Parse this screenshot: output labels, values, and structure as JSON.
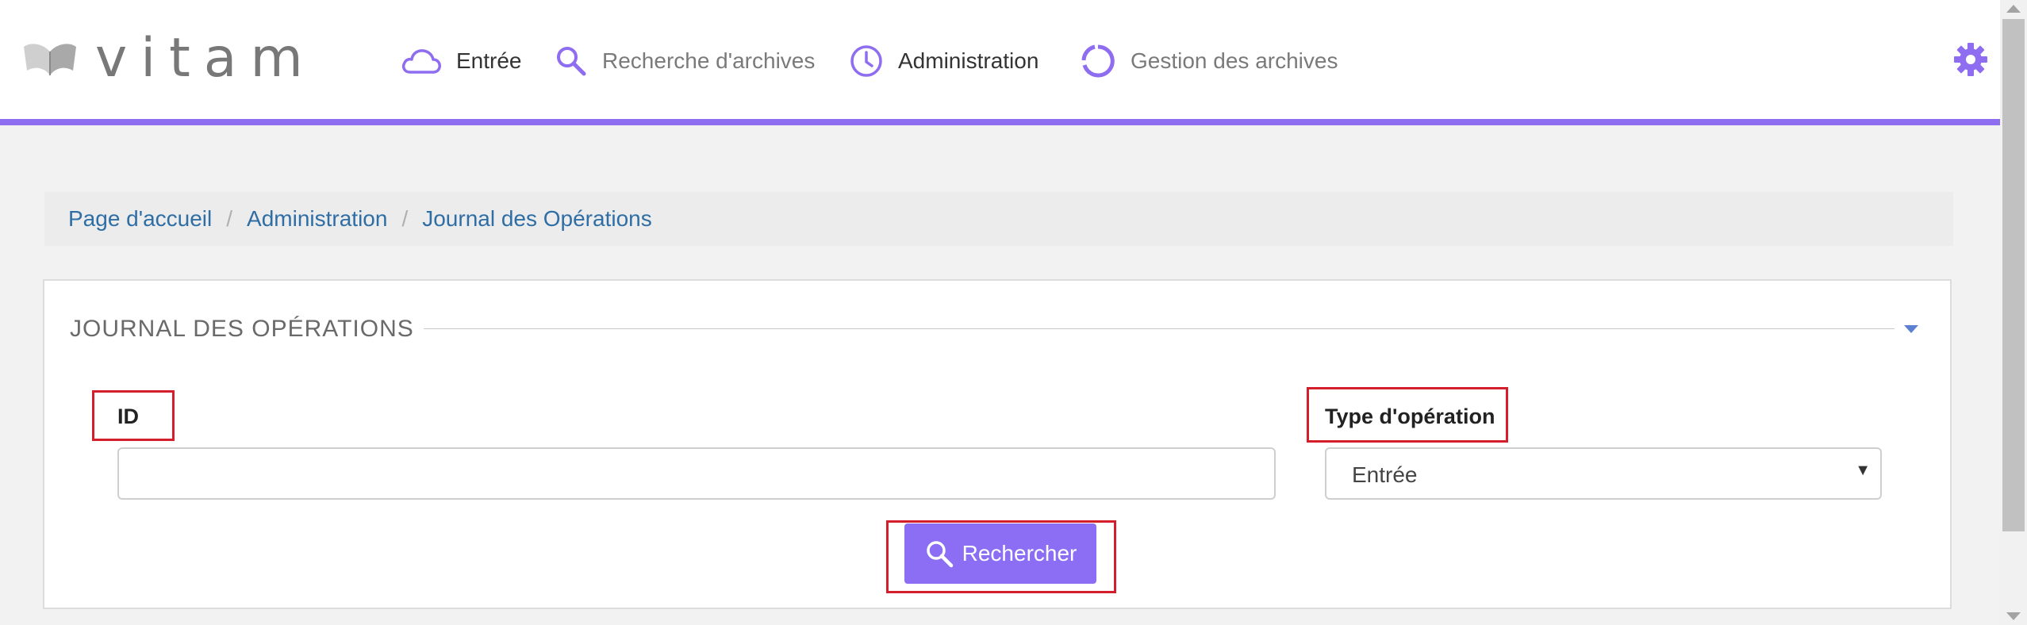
{
  "app": {
    "logo_text": "vitam"
  },
  "nav": {
    "items": [
      {
        "label": "Entrée",
        "icon": "cloud-icon"
      },
      {
        "label": "Recherche d'archives",
        "icon": "search-icon"
      },
      {
        "label": "Administration",
        "icon": "clock-icon"
      },
      {
        "label": "Gestion des archives",
        "icon": "circle-progress-icon"
      }
    ],
    "settings_icon": "gear-icon"
  },
  "breadcrumb": {
    "items": [
      "Page d'accueil",
      "Administration",
      "Journal des Opérations"
    ],
    "separator": "/"
  },
  "panel": {
    "title": "JOURNAL DES OPÉRATIONS",
    "collapse_icon": "caret-down-icon"
  },
  "form": {
    "id_label": "ID",
    "id_value": "",
    "type_label": "Type d'opération",
    "type_value": "Entrée",
    "search_button": "Rechercher"
  },
  "colors": {
    "accent": "#8e6df0",
    "button": "#8c6ef4",
    "highlight": "#d41e2b",
    "link": "#2f6ea5"
  }
}
